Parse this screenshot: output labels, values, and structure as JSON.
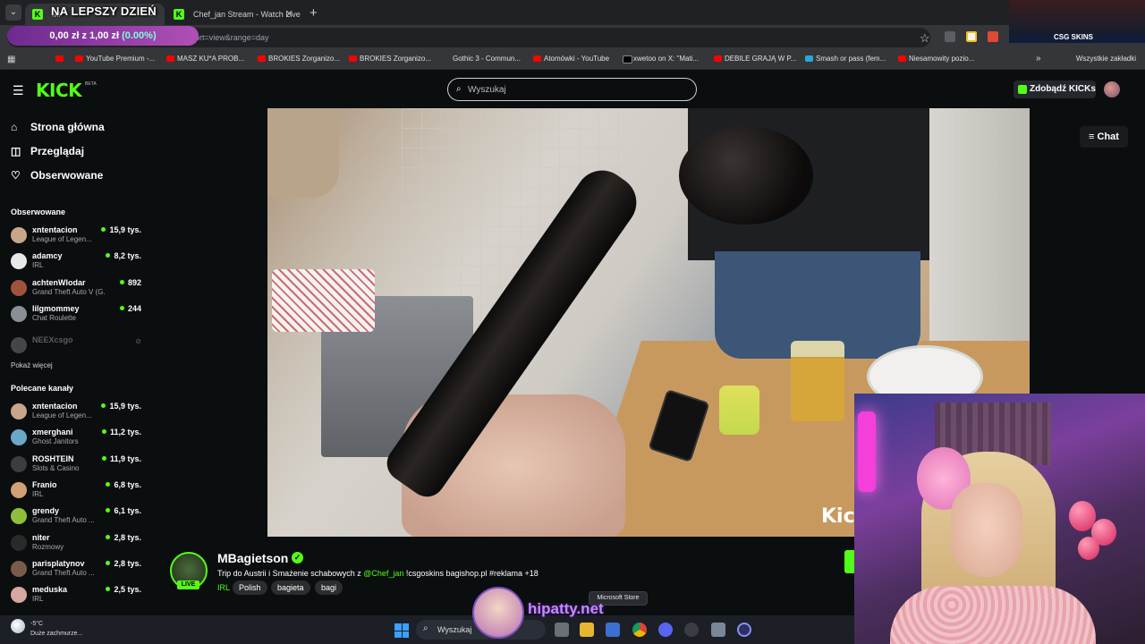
{
  "browser": {
    "tabs": [
      {
        "label": "Mi"
      },
      {
        "label": "Chef_jan Stream - Watch Live o"
      }
    ],
    "url_fragment": "ort=view&range=day",
    "bookmarks": [
      "YouTube Premium -...",
      "MASZ KU*A PROB...",
      "BROKIES Zorganizo...",
      "BROKIES Zorganizo...",
      "Gothic 3 - Commun...",
      "Atomówki - YouTube",
      "xwetoo on X: \"Mati...",
      "DEBILE GRAJĄ W P...",
      "Smash or pass (fem...",
      "Niesamowity pozio..."
    ],
    "all_bookmarks": "Wszystkie zakładki"
  },
  "overlay": {
    "title": "NA LEPSZY DZIEŃ",
    "donation_prefix": "0,00 zł",
    "donation_mid": " z 1,00 zł ",
    "donation_pct": "(0.00%)",
    "sponsor_label": "CSG SKINS"
  },
  "kick": {
    "logo": "KICK",
    "beta": "BETA",
    "search_placeholder": "Wyszukaj",
    "get_kicks": "Zdobądź KICKs",
    "nav": {
      "home": "Strona główna",
      "browse": "Przeglądaj",
      "following": "Obserwowane"
    },
    "followed_title": "Obserwowane",
    "followed": [
      {
        "name": "xntentacion",
        "category": "League of Legen...",
        "viewers": "15,9 tys.",
        "avatar_color": "#c9a68a"
      },
      {
        "name": "adamcy",
        "category": "IRL",
        "viewers": "8,2 tys.",
        "avatar_color": "#e8e8e8"
      },
      {
        "name": "achtenWlodar",
        "category": "Grand Theft Auto V (G...",
        "viewers": "892",
        "avatar_color": "#a0523d"
      },
      {
        "name": "lilgmommey",
        "category": "Chat Roulette",
        "viewers": "244",
        "avatar_color": "#8a8f96"
      }
    ],
    "offline_channel": "NEEXcsgo",
    "show_more": "Pokaż więcej",
    "recommended_title": "Polecane kanały",
    "recommended": [
      {
        "name": "xntentacion",
        "category": "League of Legen...",
        "viewers": "15,9 tys.",
        "avatar_color": "#c9a68a"
      },
      {
        "name": "xmerghani",
        "category": "Ghost Janitors",
        "viewers": "11,2 tys.",
        "avatar_color": "#6aa8c9"
      },
      {
        "name": "ROSHTEIN",
        "category": "Slots & Casino",
        "viewers": "11,9 tys.",
        "avatar_color": "#3d3d3d"
      },
      {
        "name": "Franio",
        "category": "IRL",
        "viewers": "6,8 tys.",
        "avatar_color": "#d2a074"
      },
      {
        "name": "grendy",
        "category": "Grand Theft Auto ...",
        "viewers": "6,1 tys.",
        "avatar_color": "#8fbf3a"
      },
      {
        "name": "niter",
        "category": "Rozmowy",
        "viewers": "2,8 tys.",
        "avatar_color": "#2a2a2a"
      },
      {
        "name": "parisplatynov",
        "category": "Grand Theft Auto ...",
        "viewers": "2,8 tys.",
        "avatar_color": "#7a5b4a"
      },
      {
        "name": "meduska",
        "category": "IRL",
        "viewers": "2,5 tys.",
        "avatar_color": "#d8a6a0"
      }
    ],
    "chat_button": "Chat",
    "video_watermark": "Kic"
  },
  "stream": {
    "streamer": "MBagietson",
    "live_label": "LIVE",
    "title_start": "Trip do Austrii  i Smażenie schabowych z ",
    "title_mention": "@Chef_jan",
    "title_end": " !csgoskins bagishop.pl #reklama +18",
    "category": "IRL",
    "tags": [
      "Polish",
      "bagieta",
      "bagi"
    ]
  },
  "taskbar": {
    "temperature": "-5°C",
    "weather": "Duże zachmurze...",
    "search_placeholder": "Wyszukaj",
    "tooltip": "Microsoft Store",
    "overlay_brand": "hipatty.net"
  }
}
